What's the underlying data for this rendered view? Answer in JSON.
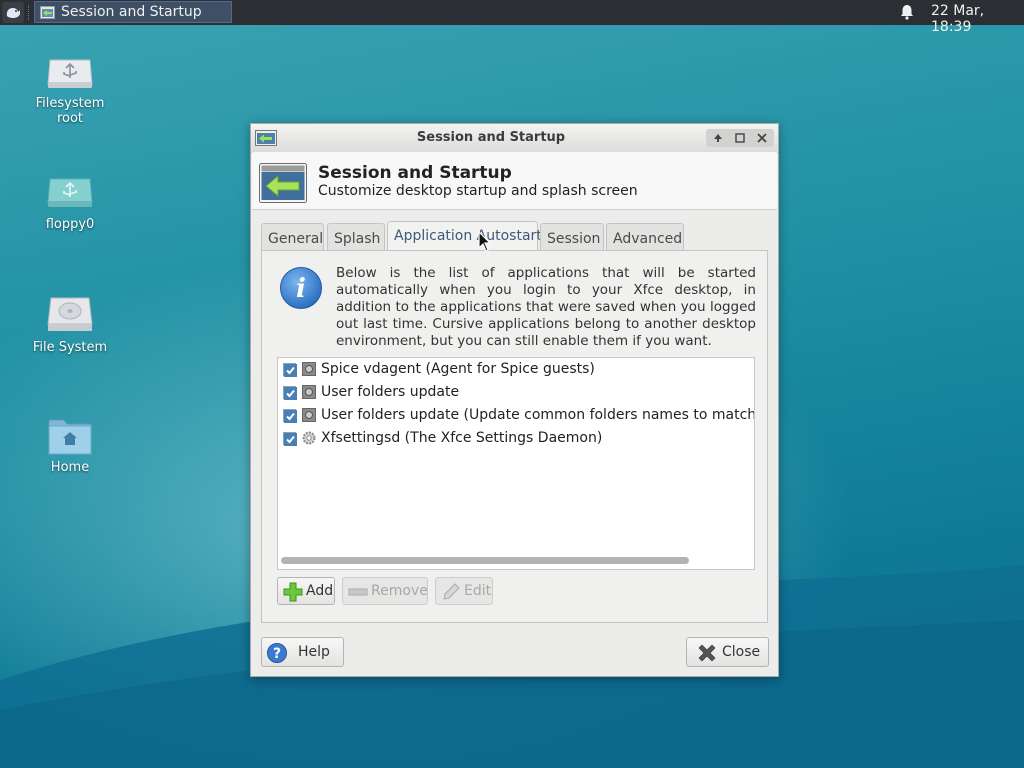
{
  "panel": {
    "task_title": "Session and Startup",
    "clock": "22 Mar, 18:39"
  },
  "desktop": {
    "icons": [
      {
        "label_line1": "Filesystem",
        "label_line2": "root",
        "icon": "usb-drive-icon"
      },
      {
        "label": "floppy0",
        "icon": "usb-drive-icon"
      },
      {
        "label": "File System",
        "icon": "hard-drive-icon"
      },
      {
        "label": "Home",
        "icon": "home-folder-icon"
      }
    ]
  },
  "window": {
    "title": "Session and Startup",
    "header_title": "Session and Startup",
    "header_subtitle": "Customize desktop startup and splash screen",
    "tabs": [
      {
        "label": "General"
      },
      {
        "label": "Splash"
      },
      {
        "label": "Application Autostart",
        "active": true
      },
      {
        "label": "Session"
      },
      {
        "label": "Advanced"
      }
    ],
    "info_text": "Below is the list of applications that will be started automatically when you login to your Xfce desktop, in addition to the applications that were saved when you logged out last time. Cursive applications belong to another desktop environment, but you can still enable them if you want.",
    "autostart_items": [
      {
        "label": "Spice vdagent (Agent for Spice guests)",
        "checked": true
      },
      {
        "label": "User folders update",
        "checked": true
      },
      {
        "label": "User folders update (Update common folders names to match curr",
        "checked": true
      },
      {
        "label": "Xfsettingsd (The Xfce Settings Daemon)",
        "checked": true
      }
    ],
    "buttons": {
      "add": "Add",
      "remove": "Remove",
      "edit": "Edit",
      "help": "Help",
      "close": "Close"
    }
  },
  "colors": {
    "desktop_teal": "#1d8ea2",
    "panel_bg": "#2b2f33",
    "active_tab_text": "#3d5a78"
  }
}
